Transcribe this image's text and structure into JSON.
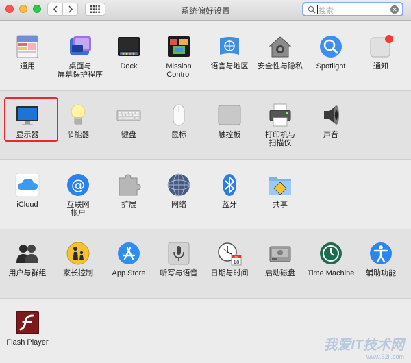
{
  "window": {
    "title": "系统偏好设置"
  },
  "search": {
    "placeholder": "搜索"
  },
  "icons": {
    "back": "chevron-left-icon",
    "forward": "chevron-right-icon",
    "grid": "grid-icon",
    "search": "magnifier-icon",
    "clear": "clear-icon"
  },
  "rows": [
    {
      "items": [
        {
          "name": "general",
          "label": "通用"
        },
        {
          "name": "desktop",
          "label": "桌面与\n屏幕保护程序"
        },
        {
          "name": "dock",
          "label": "Dock"
        },
        {
          "name": "mission",
          "label": "Mission\nControl"
        },
        {
          "name": "language",
          "label": "语言与地区"
        },
        {
          "name": "security",
          "label": "安全性与隐私"
        },
        {
          "name": "spotlight",
          "label": "Spotlight"
        },
        {
          "name": "notifications",
          "label": "通知"
        }
      ]
    },
    {
      "items": [
        {
          "name": "displays",
          "label": "显示器",
          "highlighted": true
        },
        {
          "name": "energy",
          "label": "节能器"
        },
        {
          "name": "keyboard",
          "label": "键盘"
        },
        {
          "name": "mouse",
          "label": "鼠标"
        },
        {
          "name": "trackpad",
          "label": "触控板"
        },
        {
          "name": "printers",
          "label": "打印机与\n扫描仪"
        },
        {
          "name": "sound",
          "label": "声音"
        }
      ]
    },
    {
      "items": [
        {
          "name": "icloud",
          "label": "iCloud"
        },
        {
          "name": "internet-accounts",
          "label": "互联网\n帐户"
        },
        {
          "name": "extensions",
          "label": "扩展"
        },
        {
          "name": "network",
          "label": "网络"
        },
        {
          "name": "bluetooth",
          "label": "蓝牙"
        },
        {
          "name": "sharing",
          "label": "共享"
        }
      ]
    },
    {
      "items": [
        {
          "name": "users",
          "label": "用户与群组"
        },
        {
          "name": "parental",
          "label": "家长控制"
        },
        {
          "name": "appstore",
          "label": "App Store"
        },
        {
          "name": "dictation",
          "label": "听写与语音"
        },
        {
          "name": "datetime",
          "label": "日期与时间"
        },
        {
          "name": "startup",
          "label": "启动磁盘"
        },
        {
          "name": "timemachine",
          "label": "Time Machine"
        },
        {
          "name": "accessibility",
          "label": "辅助功能"
        }
      ]
    },
    {
      "items": [
        {
          "name": "flashplayer",
          "label": "Flash Player"
        }
      ]
    }
  ],
  "calendar_icon": {
    "month": "JUL",
    "day": "18"
  },
  "watermark": {
    "title": "我爱IT技术网",
    "url": "www.52ij.com"
  }
}
